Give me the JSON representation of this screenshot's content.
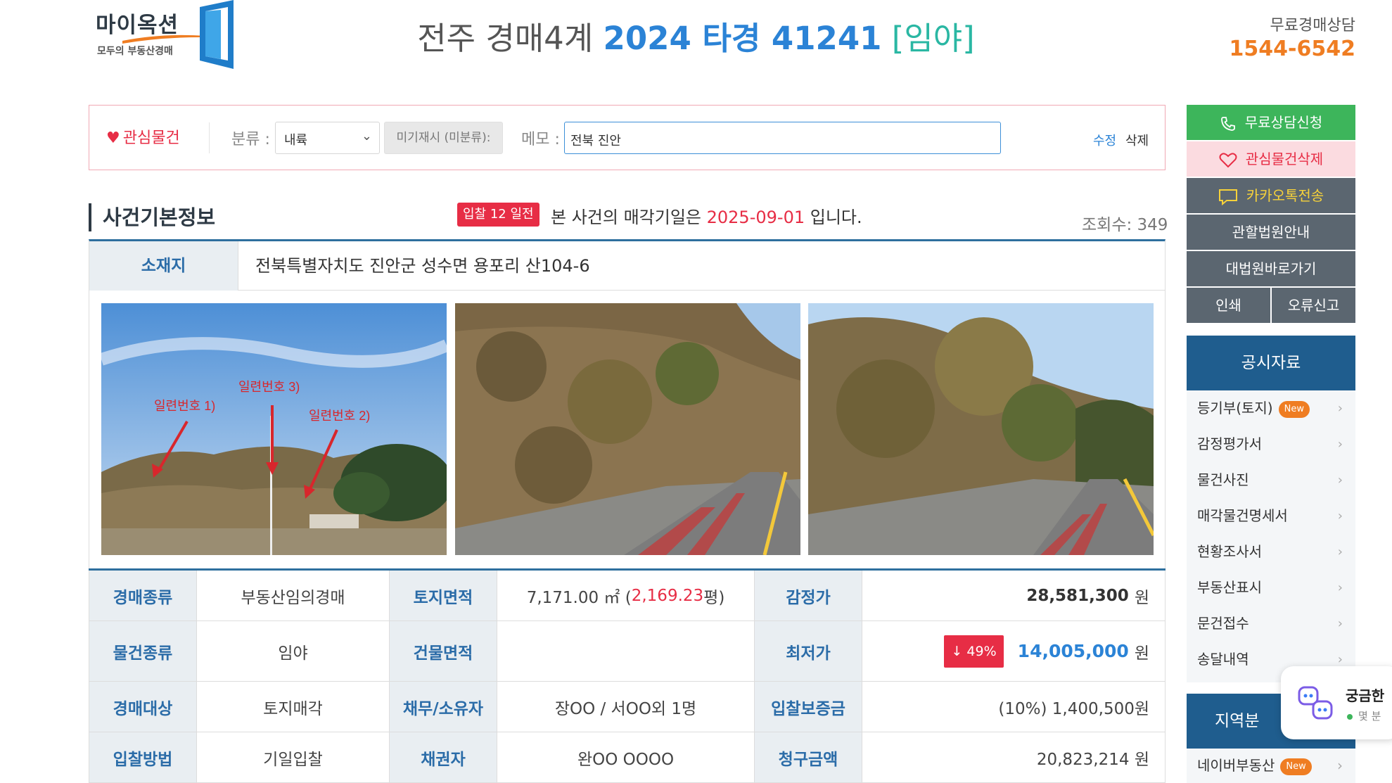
{
  "header": {
    "logo_main": "마이옥션",
    "logo_sub": "모두의 부동산경매",
    "court": "전주 경매4계",
    "case_number": "2024 타경 41241",
    "property_type_tag": "[임야]",
    "hotline_label": "무료경매상담",
    "hotline_number": "1544-6542"
  },
  "interest_bar": {
    "favorite_label": "관심물건",
    "classification_label": "분류 :",
    "classification_value": "내륙",
    "unsorted_button": "미기재시 (미분류):",
    "memo_label": "메모 :",
    "memo_value": "전북 진안",
    "edit_label": "수정",
    "delete_label": "삭제"
  },
  "case_info": {
    "section_title": "사건기본정보",
    "dday_badge": "입찰 12 일전",
    "sale_notice_prefix": "본 사건의 매각기일은",
    "sale_date": "2025-09-01",
    "sale_notice_suffix": "입니다.",
    "views_label": "조회수: 349",
    "address_label": "소재지",
    "address_value": "전북특별자치도 진안군 성수면 용포리 산104-6",
    "photo_annotations": [
      "일련번호 1)",
      "일련번호 3)",
      "일련번호 2)"
    ]
  },
  "details": {
    "auction_type_label": "경매종류",
    "auction_type_value": "부동산임의경매",
    "land_area_label": "토지면적",
    "land_area_prefix": "7,171.00 ㎡ (",
    "land_area_pyeong": "2,169.23",
    "land_area_suffix": "평)",
    "appraisal_label": "감정가",
    "appraisal_value": "28,581,300",
    "item_type_label": "물건종류",
    "item_type_value": "임야",
    "building_area_label": "건물면적",
    "building_area_value": "",
    "min_price_label": "최저가",
    "min_price_drop": "↓ 49%",
    "min_price_value": "14,005,000",
    "auction_target_label": "경매대상",
    "auction_target_value": "토지매각",
    "debtor_owner_label": "채무/소유자",
    "debtor_owner_value": "장OO / 서OO외 1명",
    "deposit_label": "입찰보증금",
    "deposit_value": "(10%) 1,400,500원",
    "bid_method_label": "입찰방법",
    "bid_method_value": "기일입찰",
    "creditor_label": "채권자",
    "creditor_value": "완OO OOOO",
    "claim_label": "청구금액",
    "claim_value": "20,823,214 원",
    "won": "원"
  },
  "sidebar": {
    "consult_button": "무료상담신청",
    "remove_fav_button": "관심물건삭제",
    "kakao_button": "카카오톡전송",
    "court_info_button": "관할법원안내",
    "supreme_court_button": "대법원바로가기",
    "print_button": "인쇄",
    "report_button": "오류신고",
    "notice_title": "공시자료",
    "notice_items": [
      "등기부(토지)",
      "감정평가서",
      "물건사진",
      "매각물건명세서",
      "현황조사서",
      "부동산표시",
      "문건접수",
      "송달내역"
    ],
    "new_badge": "New",
    "region_title": "지역분",
    "naver_item": "네이버부동산"
  },
  "chat_widget": {
    "title": "궁금한",
    "status": "몇 분"
  },
  "colors": {
    "accent_blue": "#2b83d6",
    "accent_red": "#e72d45",
    "accent_green": "#3db55b",
    "accent_orange": "#ef7d22",
    "navy": "#1f5d8e"
  }
}
